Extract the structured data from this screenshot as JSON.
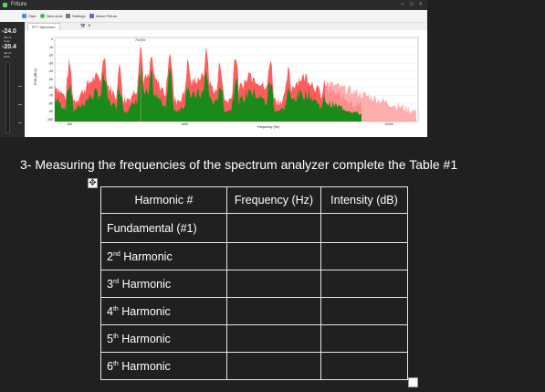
{
  "app": {
    "title": "Friture",
    "toolbar": [
      {
        "label": "Start",
        "icon": "play-icon",
        "color": "#4a90d9"
      },
      {
        "label": "New dock",
        "icon": "add-icon",
        "color": "#3fbf3f"
      },
      {
        "label": "Settings",
        "icon": "tools-icon",
        "color": "#777777"
      },
      {
        "label": "About Friture",
        "icon": "info-icon",
        "color": "#6666cc"
      }
    ],
    "tab": {
      "label": "FFT Spectrum"
    },
    "meters": [
      {
        "value": "-24.0",
        "unit": "dB FS",
        "mode": "Peak"
      },
      {
        "value": "-20.4",
        "unit": "dB FS",
        "mode": "RMS"
      }
    ],
    "plot": {
      "marker_label": "714 Hz",
      "ylabel": "PSD (dB A)",
      "xlabel": "Frequency (Hz)",
      "yticks": [
        "0",
        "-10",
        "-20",
        "-30",
        "-40",
        "-50",
        "-60",
        "-70",
        "-80",
        "-90",
        "-100"
      ],
      "xticks": [
        "100",
        "1000",
        "10000"
      ]
    }
  },
  "colors": {
    "peak": "#ff4a4a",
    "spectrum": "#1a8a1a",
    "accent": "#3fbf3f"
  },
  "document": {
    "question": "3- Measuring the frequencies of the spectrum analyzer complete the Table #1",
    "table": {
      "headers": [
        "Harmonic #",
        "Frequency (Hz)",
        "Intensity (dB)"
      ],
      "rows": [
        {
          "label": "Fundamental (#1)",
          "num": "",
          "sup": "",
          "rest": ""
        },
        {
          "label": "",
          "num": "2",
          "sup": "nd",
          "rest": " Harmonic"
        },
        {
          "label": "",
          "num": "3",
          "sup": "rd",
          "rest": " Harmonic"
        },
        {
          "label": "",
          "num": "4",
          "sup": "th",
          "rest": " Harmonic"
        },
        {
          "label": "",
          "num": "5",
          "sup": "th",
          "rest": " Harmonic"
        },
        {
          "label": "",
          "num": "6",
          "sup": "th",
          "rest": " Harmonic"
        }
      ]
    }
  }
}
